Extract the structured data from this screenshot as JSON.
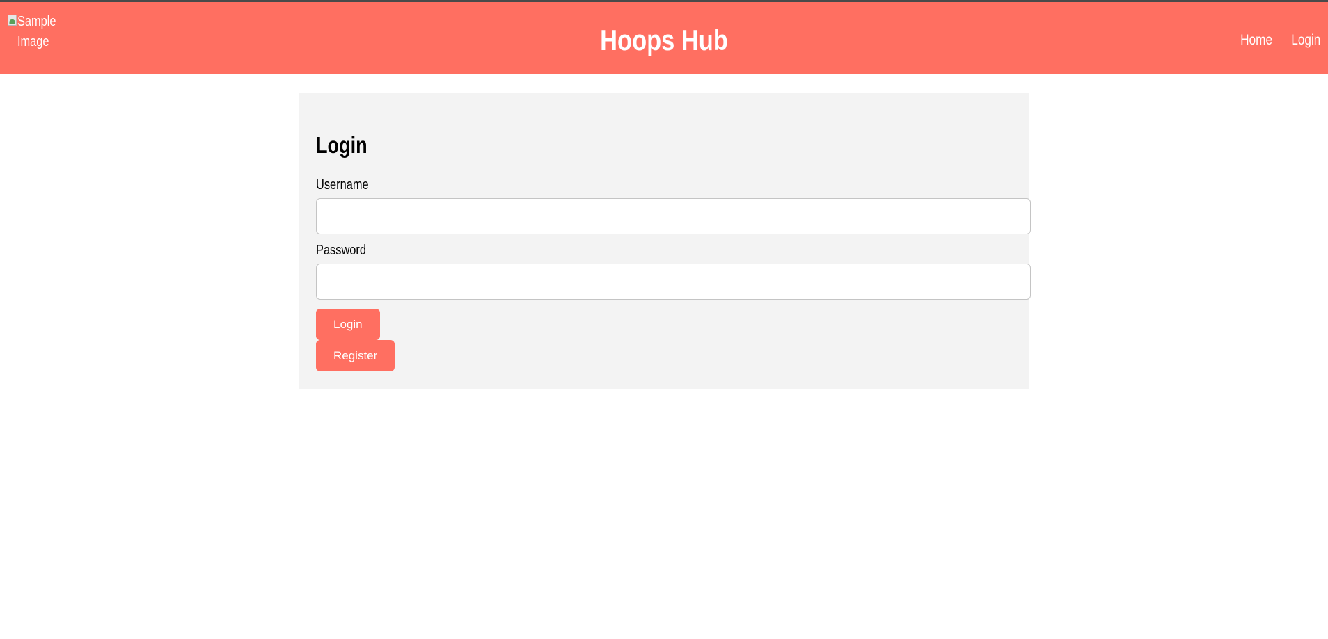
{
  "header": {
    "logo_alt": "Sample Image",
    "title": "Hoops Hub",
    "nav": [
      {
        "label": "Home"
      },
      {
        "label": "Login"
      }
    ]
  },
  "login_form": {
    "heading": "Login",
    "username_label": "Username",
    "username_value": "",
    "password_label": "Password",
    "password_value": "",
    "login_button": "Login",
    "register_button": "Register"
  },
  "colors": {
    "brand": "#ff6f61",
    "card_background": "#f3f3f3",
    "page_background": "#ffffff"
  }
}
